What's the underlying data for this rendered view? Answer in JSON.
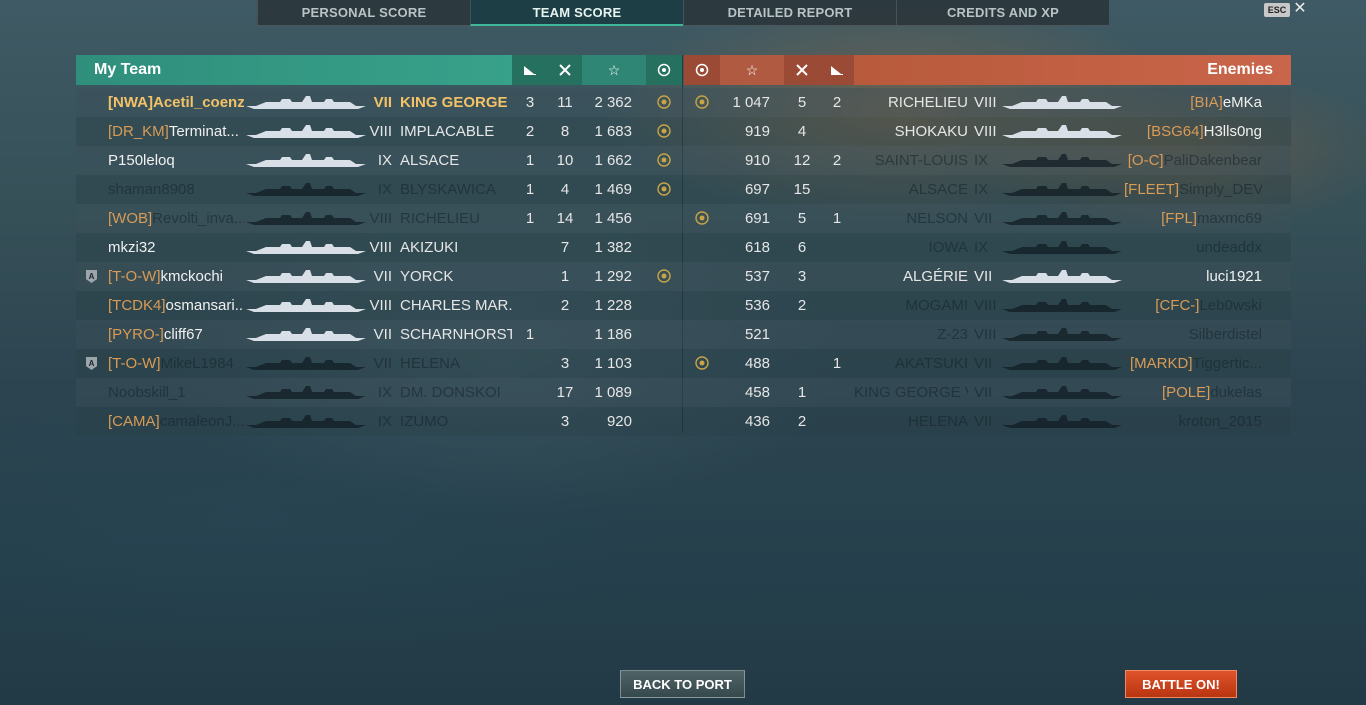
{
  "tabs": [
    {
      "label": "PERSONAL SCORE"
    },
    {
      "label": "TEAM SCORE"
    },
    {
      "label": "DETAILED REPORT"
    },
    {
      "label": "CREDITS AND XP"
    }
  ],
  "window": {
    "esc_label": "ESC",
    "close_glyph": "✕"
  },
  "header": {
    "my_team": "My Team",
    "enemies": "Enemies",
    "icons": [
      "torpedo-icon",
      "kills-icon",
      "score-star-icon",
      "medal-icon"
    ]
  },
  "my_team": [
    {
      "badge": "",
      "clan": "[NWA]",
      "name": "Acetil_coenzi...",
      "tier": "VII",
      "ship": "KING GEORGE V",
      "c1": "3",
      "c2": "11",
      "score": "2 362",
      "medal": true,
      "style": "me"
    },
    {
      "badge": "",
      "clan": "[DR_KM]",
      "name": "Terminat...",
      "tier": "VIII",
      "ship": "IMPLACABLE",
      "c1": "2",
      "c2": "8",
      "score": "1 683",
      "medal": true,
      "style": "alive"
    },
    {
      "badge": "",
      "clan": "",
      "name": "P150leloq",
      "tier": "IX",
      "ship": "ALSACE",
      "c1": "1",
      "c2": "10",
      "score": "1 662",
      "medal": true,
      "style": "alive"
    },
    {
      "badge": "",
      "clan": "",
      "name": "shaman8908",
      "tier": "IX",
      "ship": "BLYSKAWICA",
      "c1": "1",
      "c2": "4",
      "score": "1 469",
      "medal": true,
      "style": "dim"
    },
    {
      "badge": "",
      "clan": "[WOB]",
      "name": "Revolti_inva...",
      "tier": "VIII",
      "ship": "RICHELIEU",
      "c1": "1",
      "c2": "14",
      "score": "1 456",
      "medal": false,
      "style": "dim"
    },
    {
      "badge": "",
      "clan": "",
      "name": "mkzi32",
      "tier": "VIII",
      "ship": "AKIZUKI",
      "c1": "",
      "c2": "7",
      "score": "1 382",
      "medal": false,
      "style": "alive"
    },
    {
      "badge": "A",
      "clan": "[T-O-W]",
      "name": "kmckochi",
      "tier": "VII",
      "ship": "YORCK",
      "c1": "",
      "c2": "1",
      "score": "1 292",
      "medal": true,
      "style": "alive"
    },
    {
      "badge": "",
      "clan": "[TCDK4]",
      "name": "osmansari...",
      "tier": "VIII",
      "ship": "CHARLES MAR...",
      "c1": "",
      "c2": "2",
      "score": "1 228",
      "medal": false,
      "style": "alive"
    },
    {
      "badge": "",
      "clan": "[PYRO-]",
      "name": "cliff67",
      "tier": "VII",
      "ship": "SCHARNHORST",
      "c1": "1",
      "c2": "",
      "score": "1 186",
      "medal": false,
      "style": "alive"
    },
    {
      "badge": "A",
      "clan": "[T-O-W]",
      "name": "MikeL1984",
      "tier": "VII",
      "ship": "HELENA",
      "c1": "",
      "c2": "3",
      "score": "1 103",
      "medal": false,
      "style": "dim"
    },
    {
      "badge": "",
      "clan": "",
      "name": "Noobskill_1",
      "tier": "IX",
      "ship": "DM. DONSKOI",
      "c1": "",
      "c2": "17",
      "score": "1 089",
      "medal": false,
      "style": "dim"
    },
    {
      "badge": "",
      "clan": "[CAMA]",
      "name": "camaleonJ...",
      "tier": "IX",
      "ship": "IZUMO",
      "c1": "",
      "c2": "3",
      "score": "920",
      "medal": false,
      "style": "dim"
    }
  ],
  "enemies": [
    {
      "medal": true,
      "score": "1 047",
      "c2": "5",
      "c1": "2",
      "ship": "RICHELIEU",
      "tier": "VIII",
      "clan": "[BIA]",
      "name": "eMKa",
      "style": "alive"
    },
    {
      "medal": false,
      "score": "919",
      "c2": "4",
      "c1": "",
      "ship": "SHOKAKU",
      "tier": "VIII",
      "clan": "[BSG64]",
      "name": "H3lls0ng",
      "style": "alive"
    },
    {
      "medal": false,
      "score": "910",
      "c2": "12",
      "c1": "2",
      "ship": "SAINT-LOUIS",
      "tier": "IX",
      "clan": "[O-C]",
      "name": "PaliDakenbear",
      "style": "dim"
    },
    {
      "medal": false,
      "score": "697",
      "c2": "15",
      "c1": "",
      "ship": "ALSACE",
      "tier": "IX",
      "clan": "[FLEET]",
      "name": "Simply_DEVI",
      "style": "dim"
    },
    {
      "medal": true,
      "score": "691",
      "c2": "5",
      "c1": "1",
      "ship": "NELSON",
      "tier": "VII",
      "clan": "[FPL]",
      "name": "maxmc69",
      "style": "dim"
    },
    {
      "medal": false,
      "score": "618",
      "c2": "6",
      "c1": "",
      "ship": "IOWA",
      "tier": "IX",
      "clan": "",
      "name": "undeaddx",
      "style": "dim"
    },
    {
      "medal": false,
      "score": "537",
      "c2": "3",
      "c1": "",
      "ship": "ALGÉRIE",
      "tier": "VII",
      "clan": "",
      "name": "luci1921",
      "style": "alive"
    },
    {
      "medal": false,
      "score": "536",
      "c2": "2",
      "c1": "",
      "ship": "MOGAMI",
      "tier": "VIII",
      "clan": "[CFC-]",
      "name": "Leb0wski",
      "style": "dim"
    },
    {
      "medal": false,
      "score": "521",
      "c2": "",
      "c1": "",
      "ship": "Z-23",
      "tier": "VIII",
      "clan": "",
      "name": "Silberdistel",
      "style": "dim"
    },
    {
      "medal": true,
      "score": "488",
      "c2": "",
      "c1": "1",
      "ship": "AKATSUKI",
      "tier": "VII",
      "clan": "[MARKD]",
      "name": "Tiggertic...",
      "style": "dim"
    },
    {
      "medal": false,
      "score": "458",
      "c2": "1",
      "c1": "",
      "ship": "KING GEORGE V",
      "tier": "VII",
      "clan": "[POLE]",
      "name": "dukelas",
      "style": "dim"
    },
    {
      "medal": false,
      "score": "436",
      "c2": "2",
      "c1": "",
      "ship": "HELENA",
      "tier": "VII",
      "clan": "",
      "name": "kroton_2015",
      "style": "dim"
    }
  ],
  "buttons": {
    "back_to_port": "BACK TO PORT",
    "battle_on": "BATTLE ON!"
  },
  "colors": {
    "my_team_header": "#38a18a",
    "enemy_header": "#c9654a",
    "clan_tag": "#d99b55",
    "self_highlight": "#f3c267",
    "battle_button": "#e0532c"
  }
}
